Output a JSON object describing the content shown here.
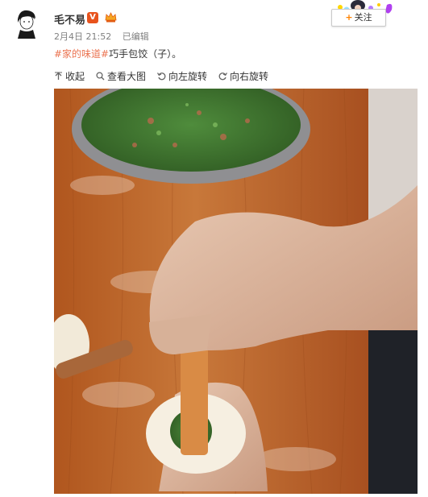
{
  "post": {
    "username": "毛不易",
    "verified_badge": "V",
    "timestamp": "2月4日 21:52",
    "edited_label": "已编辑",
    "hashtag": "#家的味道#",
    "text": "巧手包饺（子）。"
  },
  "follow_button": {
    "plus": "+",
    "label": "关注"
  },
  "toolbar": {
    "collapse": "收起",
    "view_large": "查看大图",
    "rotate_left": "向左旋转",
    "rotate_right": "向右旋转"
  },
  "colors": {
    "accent": "#ff8200",
    "hashtag": "#eb7350",
    "badge": "#e8531d"
  }
}
